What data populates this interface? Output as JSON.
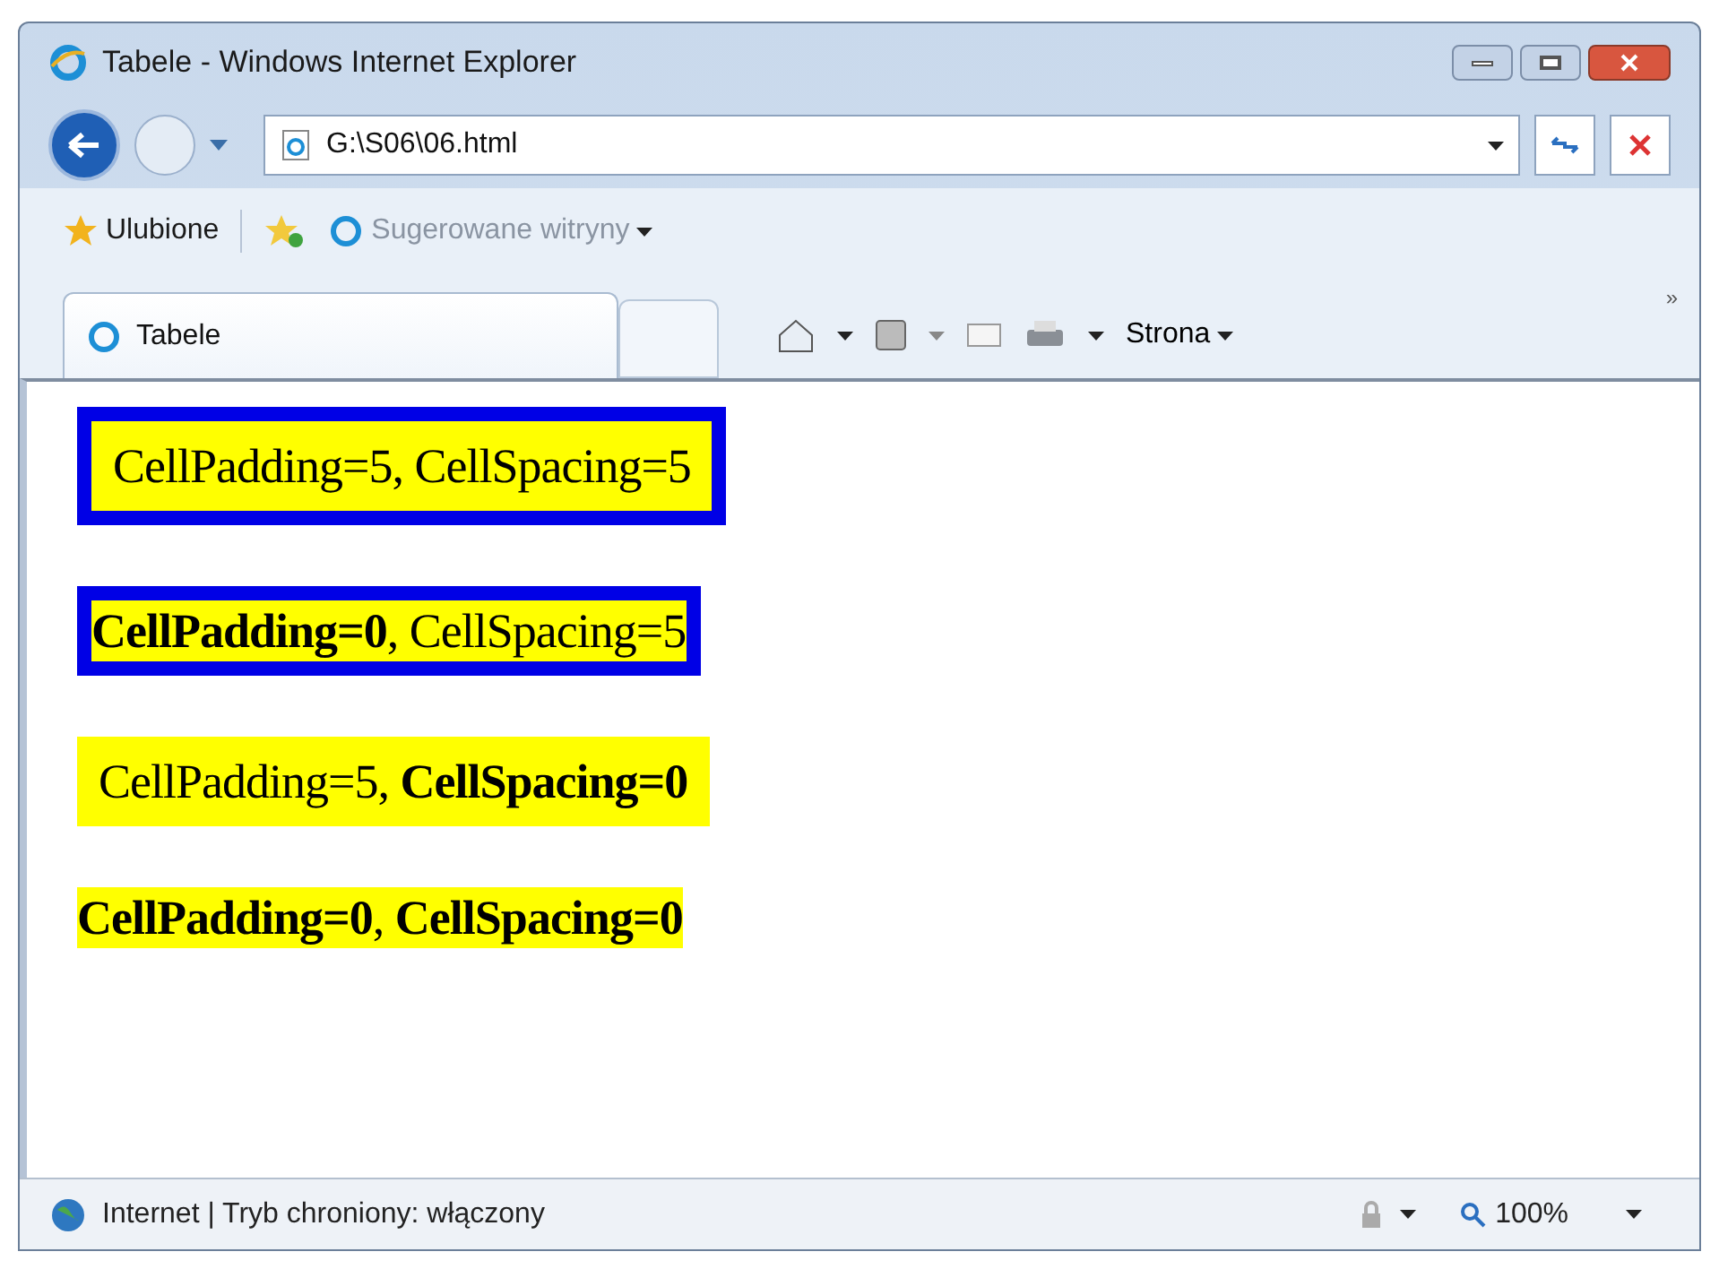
{
  "window": {
    "title": "Tabele - Windows Internet Explorer"
  },
  "address_bar": {
    "value": "G:\\S06\\06.html"
  },
  "favorites_bar": {
    "favorites": "Ulubione",
    "suggested": "Sugerowane witryny"
  },
  "tabs": [
    {
      "label": "Tabele",
      "selected": true
    }
  ],
  "command_bar": {
    "page_menu": "Strona",
    "overflow": "»"
  },
  "tables": [
    {
      "text": "CellPadding=5, CellSpacing=5",
      "padded": true,
      "spaced": true
    },
    {
      "text": "**CellPadding=0**, CellSpacing=5",
      "padded": false,
      "spaced": true
    },
    {
      "text": "CellPadding=5, **CellSpacing=0**",
      "padded": true,
      "spaced": false
    },
    {
      "text": "**CellPadding=0**, **CellSpacing=0**",
      "padded": false,
      "spaced": false
    }
  ],
  "status_bar": {
    "zone": "Internet | Tryb chroniony: włączony",
    "zoom": "100%"
  }
}
